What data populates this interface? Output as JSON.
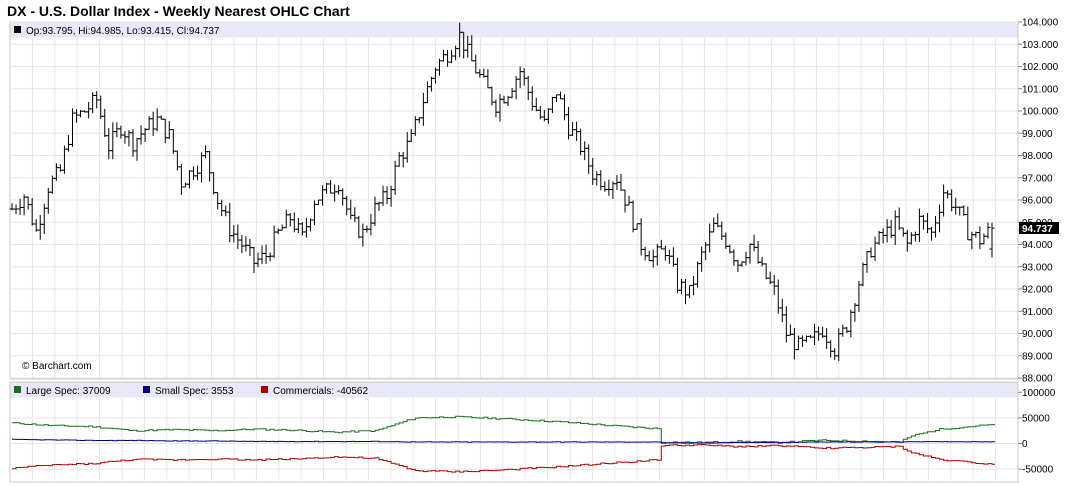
{
  "header": {
    "title": "DX - U.S. Dollar Index - Weekly Nearest OHLC Chart"
  },
  "price_panel": {
    "ohlc_label": "Op:93.795, Hi:94.985, Lo:93.415, Cl:94.737",
    "watermark": "© Barchart.com",
    "last_price_label": "94.737"
  },
  "cot_panel": {
    "legend": [
      {
        "label": "Large Spec: 37009",
        "color": "#1a6e1a"
      },
      {
        "label": "Small Spec: 3553",
        "color": "#000080"
      },
      {
        "label": "Commercials: -40562",
        "color": "#b00000"
      }
    ]
  },
  "chart_data": [
    {
      "type": "ohlc",
      "ylim": [
        88,
        104
      ],
      "yticks": [
        "104.000",
        "103.000",
        "102.000",
        "101.000",
        "100.000",
        "99.000",
        "98.000",
        "97.000",
        "96.000",
        "95.000",
        "94.000",
        "93.000",
        "92.000",
        "91.000",
        "90.000",
        "89.000",
        "88.000"
      ],
      "last": {
        "open": 93.795,
        "high": 94.985,
        "low": 93.415,
        "close": 94.737
      },
      "close_path": [
        [
          0,
          95.6
        ],
        [
          3,
          96.2
        ],
        [
          6,
          94.6
        ],
        [
          9,
          96.6
        ],
        [
          12,
          97.3
        ],
        [
          15,
          99.6
        ],
        [
          18,
          100.0
        ],
        [
          21,
          100.5
        ],
        [
          24,
          98.4
        ],
        [
          27,
          99.3
        ],
        [
          30,
          98.6
        ],
        [
          33,
          99.2
        ],
        [
          36,
          99.6
        ],
        [
          39,
          98.9
        ],
        [
          42,
          96.8
        ],
        [
          45,
          97.4
        ],
        [
          48,
          98.0
        ],
        [
          51,
          96.0
        ],
        [
          54,
          94.7
        ],
        [
          57,
          94.0
        ],
        [
          60,
          93.2
        ],
        [
          63,
          93.5
        ],
        [
          66,
          94.5
        ],
        [
          69,
          95.2
        ],
        [
          72,
          94.3
        ],
        [
          75,
          96.0
        ],
        [
          78,
          96.4
        ],
        [
          81,
          96.8
        ],
        [
          84,
          95.0
        ],
        [
          87,
          94.5
        ],
        [
          90,
          95.6
        ],
        [
          93,
          96.2
        ],
        [
          96,
          97.9
        ],
        [
          99,
          98.7
        ],
        [
          102,
          100.5
        ],
        [
          105,
          102.0
        ],
        [
          108,
          102.6
        ],
        [
          111,
          103.4
        ],
        [
          114,
          102.2
        ],
        [
          117,
          101.2
        ],
        [
          120,
          100.3
        ],
        [
          123,
          100.9
        ],
        [
          126,
          101.8
        ],
        [
          129,
          100.4
        ],
        [
          132,
          99.4
        ],
        [
          135,
          100.9
        ],
        [
          138,
          99.3
        ],
        [
          141,
          98.4
        ],
        [
          144,
          97.2
        ],
        [
          147,
          96.8
        ],
        [
          150,
          97.0
        ],
        [
          153,
          95.6
        ],
        [
          156,
          94.0
        ],
        [
          159,
          93.4
        ],
        [
          162,
          93.8
        ],
        [
          165,
          92.2
        ],
        [
          168,
          91.8
        ],
        [
          171,
          93.5
        ],
        [
          174,
          94.8
        ],
        [
          177,
          94.2
        ],
        [
          180,
          93.2
        ],
        [
          183,
          94.0
        ],
        [
          186,
          92.8
        ],
        [
          189,
          91.9
        ],
        [
          192,
          90.0
        ],
        [
          195,
          89.4
        ],
        [
          198,
          89.6
        ],
        [
          201,
          90.2
        ],
        [
          204,
          89.3
        ],
        [
          207,
          90.4
        ],
        [
          210,
          92.3
        ],
        [
          213,
          93.8
        ],
        [
          216,
          94.4
        ],
        [
          219,
          94.9
        ],
        [
          222,
          94.0
        ],
        [
          225,
          95.1
        ],
        [
          228,
          94.5
        ],
        [
          231,
          96.4
        ],
        [
          234,
          95.7
        ],
        [
          237,
          94.6
        ],
        [
          240,
          94.2
        ],
        [
          243,
          94.737
        ]
      ]
    },
    {
      "type": "line",
      "ylim": [
        -75000,
        120000
      ],
      "yticks": [
        "100000",
        "50000",
        "0",
        "-50000"
      ],
      "x": [
        0,
        10,
        20,
        30,
        40,
        50,
        60,
        70,
        80,
        90,
        100,
        110,
        120,
        130,
        140,
        150,
        160,
        161,
        170,
        180,
        190,
        200,
        210,
        220,
        223,
        230,
        243
      ],
      "series": [
        {
          "name": "Large Spec",
          "color": "#1a6e1a",
          "values": [
            40000,
            35000,
            33000,
            25000,
            27000,
            25000,
            28000,
            26000,
            22000,
            25000,
            50000,
            52000,
            49000,
            45000,
            40000,
            34000,
            29000,
            3000,
            2000,
            4000,
            2000,
            6000,
            5000,
            3000,
            15000,
            28000,
            37009
          ]
        },
        {
          "name": "Small Spec",
          "color": "#000080",
          "values": [
            8000,
            7000,
            6000,
            6000,
            5000,
            5000,
            4000,
            4000,
            4000,
            4000,
            3000,
            3000,
            3000,
            3000,
            3000,
            3000,
            3000,
            1000,
            1000,
            2000,
            2000,
            3000,
            3000,
            3000,
            3500,
            3500,
            3553
          ]
        },
        {
          "name": "Commercials",
          "color": "#b00000",
          "values": [
            -48000,
            -42000,
            -39000,
            -31000,
            -32000,
            -30000,
            -32000,
            -30000,
            -26000,
            -29000,
            -53000,
            -55000,
            -52000,
            -48000,
            -43000,
            -37000,
            -32000,
            -4000,
            -3000,
            -6000,
            -4000,
            -9000,
            -8000,
            -6000,
            -18000,
            -31000,
            -40562
          ]
        }
      ]
    }
  ]
}
